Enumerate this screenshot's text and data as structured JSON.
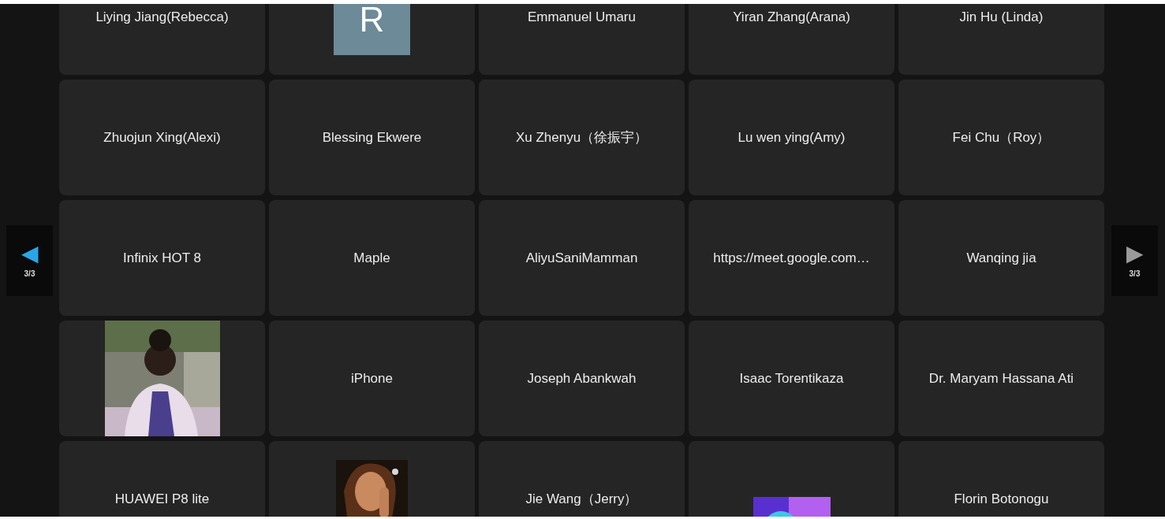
{
  "nav_prev": {
    "arrow": "◀",
    "page": "3/3",
    "disabled": false
  },
  "nav_next": {
    "arrow": "▶",
    "page": "3/3",
    "disabled": true
  },
  "tiles": [
    {
      "kind": "name",
      "name": "Liying Jiang(Rebecca)"
    },
    {
      "kind": "initial",
      "initial": "R"
    },
    {
      "kind": "name",
      "name": "Emmanuel Umaru"
    },
    {
      "kind": "name",
      "name": "Yiran Zhang(Arana)"
    },
    {
      "kind": "name",
      "name": "Jin Hu (Linda)"
    },
    {
      "kind": "name",
      "name": "Zhuojun Xing(Alexi)"
    },
    {
      "kind": "name",
      "name": "Blessing Ekwere"
    },
    {
      "kind": "name",
      "name": "Xu Zhenyu（徐振宇）"
    },
    {
      "kind": "name",
      "name": "Lu wen ying(Amy)"
    },
    {
      "kind": "name",
      "name": "Fei Chu（Roy）"
    },
    {
      "kind": "name",
      "name": "Infinix HOT 8"
    },
    {
      "kind": "name",
      "name": "Maple"
    },
    {
      "kind": "name",
      "name": "AliyuSaniMamman"
    },
    {
      "kind": "name",
      "name": "https://meet.google.com…"
    },
    {
      "kind": "name",
      "name": "Wanqing jia"
    },
    {
      "kind": "picture"
    },
    {
      "kind": "name",
      "name": "iPhone"
    },
    {
      "kind": "name",
      "name": "Joseph Abankwah"
    },
    {
      "kind": "name",
      "name": "Isaac Torentikaza"
    },
    {
      "kind": "name",
      "name": "Dr. Maryam Hassana Ati"
    },
    {
      "kind": "name",
      "name": "HUAWEI P8 lite"
    },
    {
      "kind": "picture"
    },
    {
      "kind": "name",
      "name": "Jie Wang（Jerry）"
    },
    {
      "kind": "picture"
    },
    {
      "kind": "name",
      "name": "Florin Botonogu"
    }
  ]
}
